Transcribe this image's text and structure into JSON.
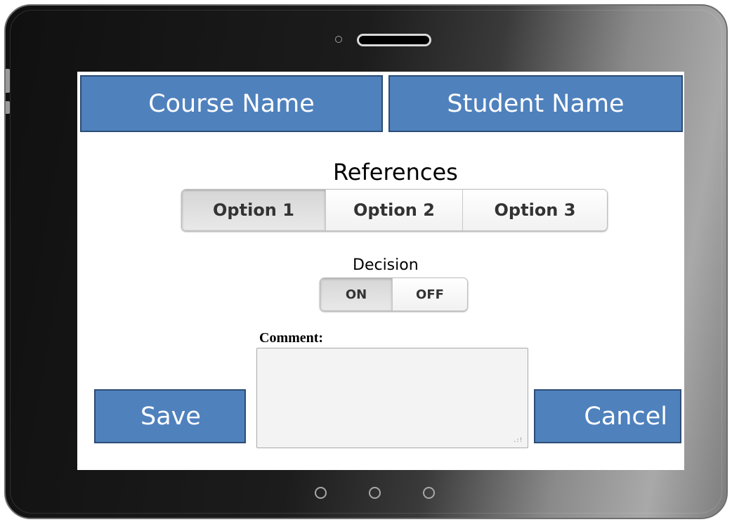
{
  "header": {
    "course_name": "Course Name",
    "student_name": "Student Name"
  },
  "references": {
    "label": "References",
    "options": [
      "Option 1",
      "Option 2",
      "Option 3"
    ],
    "selected": "Option 1"
  },
  "decision": {
    "label": "Decision",
    "on_label": "ON",
    "off_label": "OFF",
    "selected": "ON"
  },
  "comment": {
    "label": "Comment:",
    "value": ""
  },
  "actions": {
    "save": "Save",
    "cancel": "Cancel"
  },
  "colors": {
    "button_blue": "#4f81bd",
    "button_border": "#2c4d75",
    "bezel": "#1a1a1a"
  },
  "icons": {
    "resize_grip": "resize-grip-icon",
    "camera": "camera-icon",
    "speaker": "speaker-icon"
  }
}
